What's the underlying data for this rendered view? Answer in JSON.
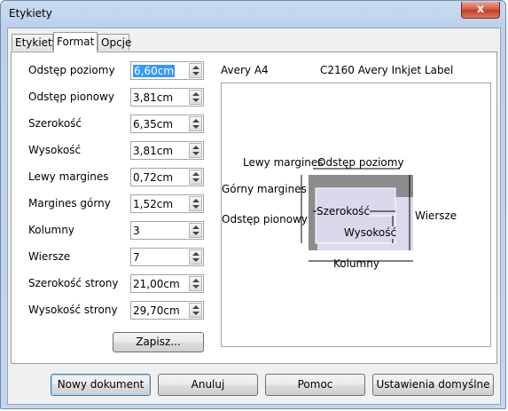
{
  "window": {
    "title": "Etykiety",
    "close_label": "x"
  },
  "tabs": [
    {
      "label": "Etykiety"
    },
    {
      "label": "Format"
    },
    {
      "label": "Opcje"
    }
  ],
  "fields": [
    {
      "label": "Odstęp poziomy",
      "value": "6,60cm"
    },
    {
      "label": "Odstęp pionowy",
      "value": "3,81cm"
    },
    {
      "label": "Szerokość",
      "value": "6,35cm"
    },
    {
      "label": "Wysokość",
      "value": "3,81cm"
    },
    {
      "label": "Lewy margines",
      "value": "0,72cm"
    },
    {
      "label": "Margines górny",
      "value": "1,52cm"
    },
    {
      "label": "Kolumny",
      "value": "3"
    },
    {
      "label": "Wiersze",
      "value": "7"
    },
    {
      "label": "Szerokość strony",
      "value": "21,00cm"
    },
    {
      "label": "Wysokość strony",
      "value": "29,70cm"
    }
  ],
  "save_button": "Zapisz...",
  "preview": {
    "brand": "Avery A4",
    "type": "C2160 Avery Inkjet Label",
    "labels": {
      "left_margin": "Lewy margines",
      "h_spacing": "Odstęp poziomy",
      "top_margin": "Górny margines",
      "v_spacing": "Odstęp pionowy",
      "width": "Szerokość",
      "height": "Wysokość",
      "rows": "Wiersze",
      "columns": "Kolumny"
    }
  },
  "buttons": {
    "new_document": "Nowy dokument",
    "cancel": "Anuluj",
    "help": "Pomoc",
    "defaults": "Ustawienia domyślne"
  }
}
